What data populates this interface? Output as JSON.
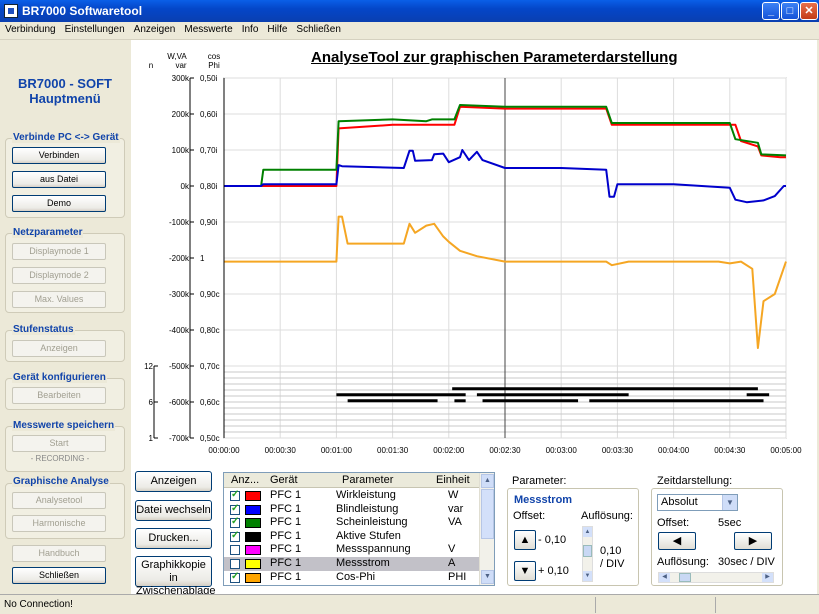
{
  "window": {
    "title": "BR7000 Softwaretool"
  },
  "menu": [
    "Verbindung",
    "Einstellungen",
    "Anzeigen",
    "Messwerte",
    "Info",
    "Hilfe",
    "Schließen"
  ],
  "sidebar": {
    "brand_line1": "BR7000 - SOFT",
    "brand_line2": "Hauptmenü",
    "connect": {
      "title": "Verbinde PC <-> Gerät",
      "btn_connect": "Verbinden",
      "btn_file": "aus Datei",
      "btn_demo": "Demo"
    },
    "net": {
      "title": "Netzparameter",
      "btn_mode1": "Displaymode 1",
      "btn_mode2": "Displaymode 2",
      "btn_max": "Max. Values"
    },
    "steps": {
      "title": "Stufenstatus",
      "btn_show": "Anzeigen"
    },
    "config": {
      "title": "Gerät konfigurieren",
      "btn_edit": "Bearbeiten"
    },
    "save": {
      "title": "Messwerte speichern",
      "btn_start": "Start",
      "recording": "- RECORDING -"
    },
    "analysis": {
      "title": "Graphische Analyse",
      "btn_tool": "Analysetool",
      "btn_harm": "Harmonische"
    },
    "btn_manual": "Handbuch",
    "btn_close": "Schließen"
  },
  "chart_title": "AnalyseTool zur graphischen Parameterdarstellung",
  "chart_data": {
    "type": "line",
    "x_ticks": [
      "00:00:00",
      "00:00:30",
      "00:01:00",
      "00:01:30",
      "00:02:00",
      "00:02:30",
      "00:03:00",
      "00:03:30",
      "00:04:00",
      "00:04:30",
      "00:05:00"
    ],
    "axis_n": {
      "header": "n",
      "ticks": [
        "12",
        "6",
        "1"
      ]
    },
    "axis_power": {
      "header1": "W,VA",
      "header2": "var",
      "ticks": [
        "300k",
        "200k",
        "100k",
        "0k",
        "-100k",
        "-200k",
        "-300k",
        "-400k",
        "-500k",
        "-600k",
        "-700k"
      ]
    },
    "axis_cos": {
      "header1": "cos",
      "header2": "Phi",
      "ticks": [
        "0,50i",
        "0,60i",
        "0,70i",
        "0,80i",
        "0,90i",
        "1",
        "0,90c",
        "0,80c",
        "0,70c",
        "0,60c",
        "0,50c"
      ]
    },
    "cursor_x": "00:02:30",
    "series": [
      {
        "color": "#FF0000",
        "points": [
          [
            0,
            0
          ],
          [
            0.33,
            0
          ],
          [
            0.4,
            0
          ],
          [
            0.46,
            0
          ],
          [
            1,
            0
          ],
          [
            1.02,
            160
          ],
          [
            1.5,
            170
          ],
          [
            1.8,
            170
          ],
          [
            1.85,
            170
          ],
          [
            2.05,
            170
          ],
          [
            2.1,
            220
          ],
          [
            2.5,
            215
          ],
          [
            3,
            215
          ],
          [
            3.4,
            215
          ],
          [
            3.45,
            170
          ],
          [
            4.4,
            170
          ],
          [
            4.55,
            170
          ],
          [
            4.6,
            125
          ],
          [
            4.75,
            110
          ],
          [
            4.78,
            85
          ],
          [
            4.95,
            80
          ],
          [
            5,
            80
          ]
        ]
      },
      {
        "color": "#008000",
        "points": [
          [
            0,
            0
          ],
          [
            0.33,
            0
          ],
          [
            0.35,
            45
          ],
          [
            1,
            45
          ],
          [
            1.02,
            180
          ],
          [
            1.5,
            185
          ],
          [
            1.8,
            180
          ],
          [
            1.85,
            185
          ],
          [
            2.05,
            185
          ],
          [
            2.1,
            225
          ],
          [
            2.5,
            220
          ],
          [
            3,
            220
          ],
          [
            3.4,
            220
          ],
          [
            3.45,
            175
          ],
          [
            4.4,
            175
          ],
          [
            4.5,
            175
          ],
          [
            4.55,
            130
          ],
          [
            4.75,
            120
          ],
          [
            4.78,
            88
          ],
          [
            5,
            85
          ]
        ]
      },
      {
        "color": "#0000CC",
        "points": [
          [
            0,
            0
          ],
          [
            0.33,
            0
          ],
          [
            0.35,
            5
          ],
          [
            1,
            5
          ],
          [
            1.02,
            58
          ],
          [
            1.05,
            55
          ],
          [
            1.6,
            50
          ],
          [
            1.65,
            98
          ],
          [
            1.68,
            98
          ],
          [
            1.7,
            70
          ],
          [
            1.85,
            72
          ],
          [
            1.87,
            88
          ],
          [
            1.95,
            90
          ],
          [
            2,
            66
          ],
          [
            2.1,
            80
          ],
          [
            2.12,
            100
          ],
          [
            2.18,
            72
          ],
          [
            2.25,
            95
          ],
          [
            2.3,
            72
          ],
          [
            2.5,
            50
          ],
          [
            3,
            50
          ],
          [
            3.4,
            45
          ],
          [
            3.43,
            -30
          ],
          [
            3.47,
            -30
          ],
          [
            3.5,
            5
          ],
          [
            4,
            5
          ],
          [
            4.5,
            -5
          ],
          [
            4.55,
            -38
          ],
          [
            4.65,
            -45
          ],
          [
            4.8,
            -40
          ],
          [
            4.9,
            -28
          ],
          [
            4.98,
            0
          ],
          [
            5,
            0
          ]
        ]
      },
      {
        "color": "#F5A623",
        "points": [
          [
            0,
            -210
          ],
          [
            0.9,
            -210
          ],
          [
            1,
            -210
          ],
          [
            1.02,
            -85
          ],
          [
            1.05,
            -85
          ],
          [
            1.1,
            -160
          ],
          [
            1.6,
            -160
          ],
          [
            1.65,
            -105
          ],
          [
            1.7,
            -130
          ],
          [
            1.8,
            -110
          ],
          [
            1.87,
            -105
          ],
          [
            1.95,
            -140
          ],
          [
            2,
            -155
          ],
          [
            2.1,
            -180
          ],
          [
            2.25,
            -195
          ],
          [
            2.5,
            -210
          ],
          [
            3.4,
            -210
          ],
          [
            3.45,
            -220
          ],
          [
            3.6,
            -210
          ],
          [
            4.4,
            -210
          ],
          [
            4.5,
            -215
          ],
          [
            4.6,
            -210
          ],
          [
            4.7,
            -230
          ],
          [
            4.75,
            -450
          ],
          [
            4.8,
            -320
          ],
          [
            4.9,
            -300
          ],
          [
            5,
            -210
          ]
        ]
      }
    ]
  },
  "step_bars": [
    {
      "row": 1,
      "segments": [
        [
          2.03,
          4.75
        ]
      ]
    },
    {
      "row": 2,
      "segments": [
        [
          1.0,
          2.15
        ],
        [
          2.25,
          3.6
        ],
        [
          4.65,
          4.85
        ]
      ]
    },
    {
      "row": 3,
      "segments": [
        [
          1.1,
          1.9
        ],
        [
          2.05,
          2.15
        ],
        [
          2.3,
          3.15
        ],
        [
          3.25,
          4.8
        ]
      ]
    }
  ],
  "buttons": {
    "show": "Anzeigen",
    "change_file": "Datei wechseln",
    "print": "Drucken...",
    "copy_line1": "Graphikkopie in",
    "copy_line2": "Zwischenablage"
  },
  "list": {
    "headers": {
      "show": "Anz...",
      "device": "Gerät",
      "param": "Parameter",
      "unit": "Einheit"
    },
    "rows": [
      {
        "checked": true,
        "color": "#FF0000",
        "device": "PFC 1",
        "param": "Wirkleistung",
        "unit": "W"
      },
      {
        "checked": true,
        "color": "#0000FF",
        "device": "PFC 1",
        "param": "Blindleistung",
        "unit": "var"
      },
      {
        "checked": true,
        "color": "#008000",
        "device": "PFC 1",
        "param": "Scheinleistung",
        "unit": "VA"
      },
      {
        "checked": true,
        "color": "#000000",
        "device": "PFC 1",
        "param": "Aktive Stufen",
        "unit": ""
      },
      {
        "checked": false,
        "color": "#FF00FF",
        "device": "PFC 1",
        "param": "Messspannung",
        "unit": "V"
      },
      {
        "checked": false,
        "color": "#FFFF00",
        "device": "PFC 1",
        "param": "Messstrom",
        "unit": "A",
        "selected": true
      },
      {
        "checked": true,
        "color": "#FFA500",
        "device": "PFC 1",
        "param": "Cos-Phi",
        "unit": "PHI"
      }
    ]
  },
  "parameter": {
    "label": "Parameter:",
    "name": "Messstrom",
    "offset_label": "Offset:",
    "resolution_label": "Auflösung:",
    "offset_up": "- 0,10",
    "offset_down": "+ 0,10",
    "resolution_value": "0,10",
    "resolution_unit": "/ DIV"
  },
  "time": {
    "label": "Zeitdarstellung:",
    "mode": "Absolut",
    "offset_label": "Offset:",
    "offset_value": "5sec",
    "resolution_label": "Auflösung:",
    "resolution_value": "30sec / DIV"
  },
  "status": "No Connection!"
}
